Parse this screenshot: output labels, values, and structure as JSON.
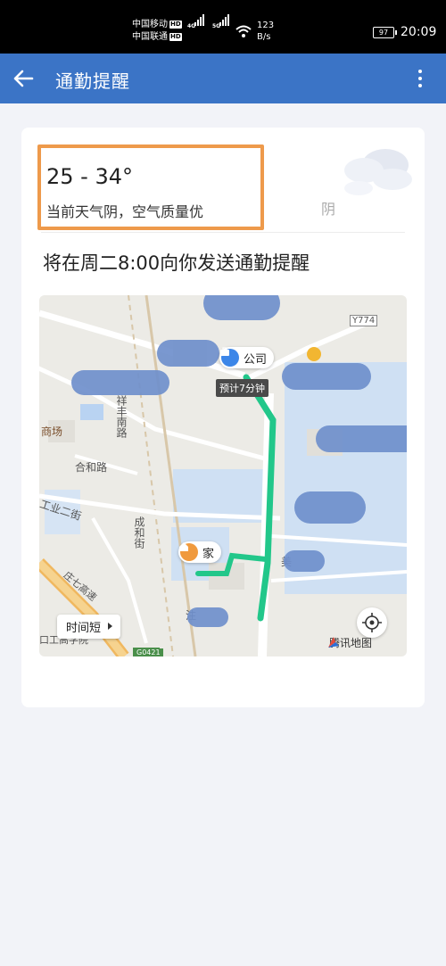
{
  "status_bar": {
    "carrier1": "中国移动",
    "carrier2": "中国联通",
    "hd": "HD",
    "net1": "4G",
    "net2": "5G",
    "speed_value": "123",
    "speed_unit": "B/s",
    "battery": "97",
    "time": "20:09"
  },
  "app_bar": {
    "title": "通勤提醒",
    "accent_color": "#3b74c6"
  },
  "weather": {
    "temperature": "25 - 34°",
    "description": "当前天气阴，空气质量优",
    "condition": "阴",
    "icon": "cloud-icon"
  },
  "reminder": {
    "text": "将在周二8:00向你发送通勤提醒"
  },
  "map": {
    "company_label": "公司",
    "home_label": "家",
    "eta": "预计7分钟",
    "traffic_button": "时间短",
    "logo": "腾讯地图",
    "route_color": "#22c78a",
    "road_labels": {
      "y774": "Y774",
      "mall": "商场",
      "xiangfeng": "祥丰南路",
      "hehe": "合和路",
      "gongye": "工业二街",
      "chenghe": "成和街",
      "g0421": "G0421",
      "mei": "美",
      "zhu": "注",
      "highway": "庄七高速",
      "school": "口工高学院"
    }
  }
}
